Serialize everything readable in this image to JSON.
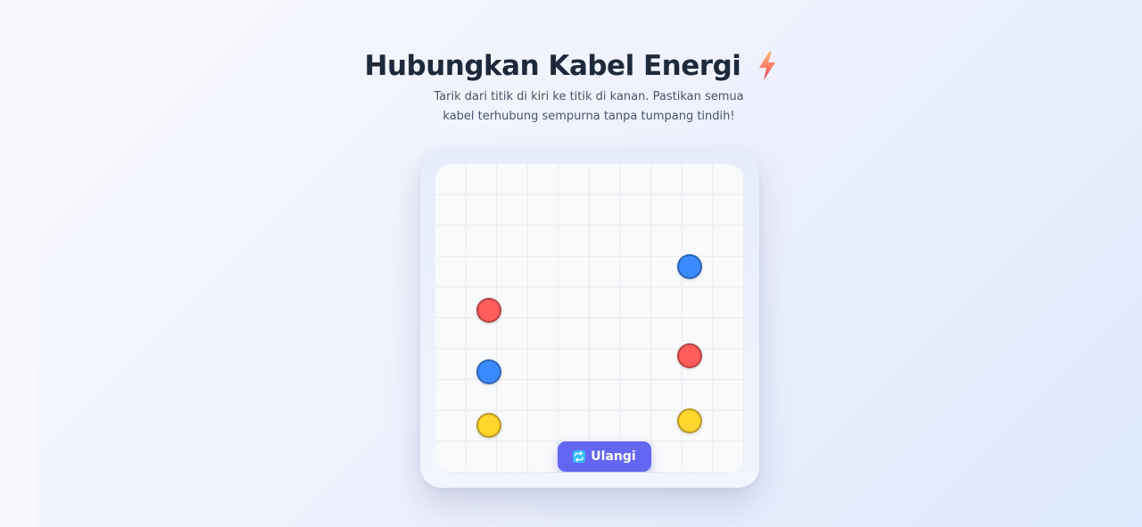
{
  "header": {
    "title": "Hubungkan Kabel Energi",
    "subtitle": "Tarik dari titik di kiri ke titik di kanan. Pastikan semua kabel terhubung sempurna tanpa tumpang tindih!"
  },
  "icons": {
    "title_icon": "lightning-bolt-icon",
    "reset_icon": "repeat-icon"
  },
  "colors": {
    "red": "#ff5c5c",
    "blue": "#3b8bff",
    "yellow": "#ffd52e",
    "button": "#6366f1"
  },
  "board": {
    "grid_size": 10,
    "left_dots": [
      {
        "color": "red"
      },
      {
        "color": "blue"
      },
      {
        "color": "yellow"
      }
    ],
    "right_dots": [
      {
        "color": "blue"
      },
      {
        "color": "red"
      },
      {
        "color": "yellow"
      }
    ]
  },
  "controls": {
    "reset_label": "Ulangi"
  }
}
